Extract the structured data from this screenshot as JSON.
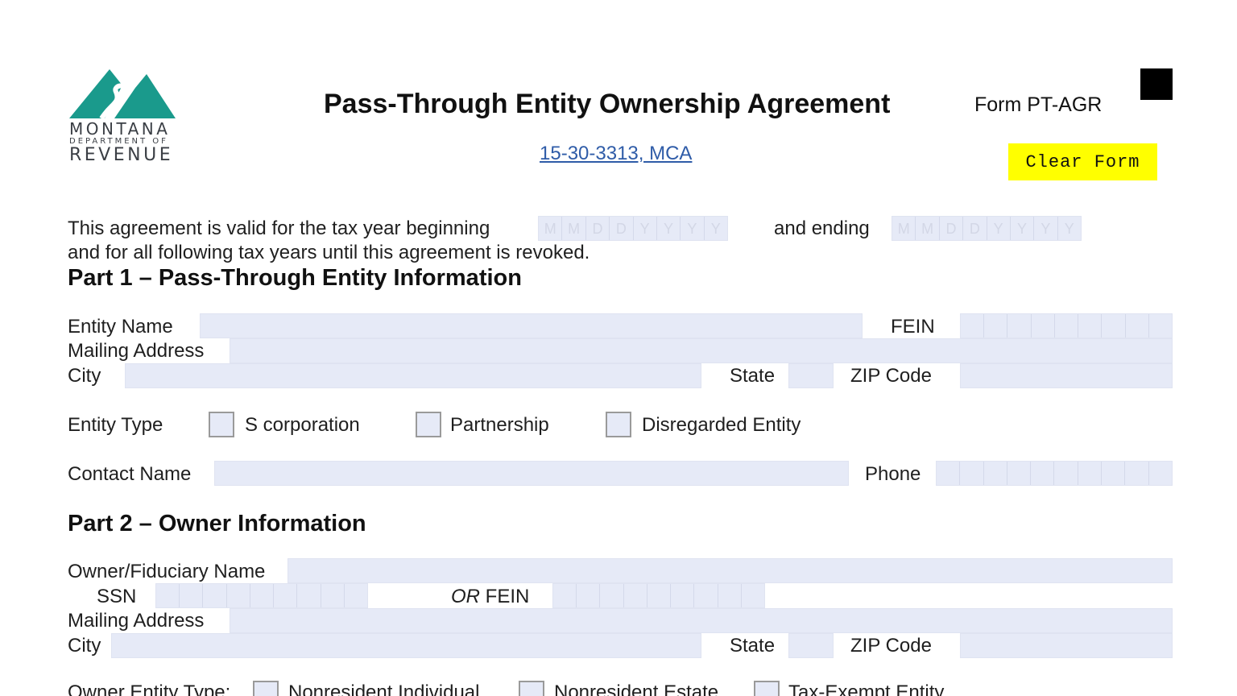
{
  "header": {
    "logo": {
      "line1": "MONTANA",
      "line2": "DEPARTMENT OF",
      "line3": "REVENUE",
      "mountain_color": "#1a9a8c"
    },
    "title": "Pass-Through Entity Ownership Agreement",
    "form_id": "Form PT-AGR",
    "statute_link": "15-30-3313, MCA",
    "clear_button": "Clear Form"
  },
  "validity": {
    "line1": "This agreement is valid for the tax year beginning",
    "and_ending": "and ending",
    "line2": "and for all following tax years until this agreement is revoked.",
    "date_placeholder": [
      "M",
      "M",
      "D",
      "D",
      "Y",
      "Y",
      "Y",
      "Y"
    ]
  },
  "part1": {
    "heading": "Part 1 – Pass-Through Entity Information",
    "entity_name": "Entity Name",
    "fein": "FEIN",
    "mailing_address": "Mailing Address",
    "city": "City",
    "state": "State",
    "zip": "ZIP Code",
    "entity_type": "Entity Type",
    "options": [
      "S corporation",
      "Partnership",
      "Disregarded Entity"
    ],
    "contact_name": "Contact Name",
    "phone": "Phone"
  },
  "part2": {
    "heading": "Part 2 – Owner Information",
    "owner_name": "Owner/Fiduciary Name",
    "ssn": "SSN",
    "or": "OR",
    "fein": "FEIN",
    "mailing_address": "Mailing Address",
    "city": "City",
    "state": "State",
    "zip": "ZIP Code",
    "owner_entity_type": "Owner Entity Type:",
    "options": [
      "Nonresident Individual",
      "Nonresident Estate",
      "Tax-Exempt Entity"
    ]
  },
  "colors": {
    "field_fill": "#e6eaf7",
    "clear_button": "#ffff00",
    "link": "#2f5ca8"
  }
}
